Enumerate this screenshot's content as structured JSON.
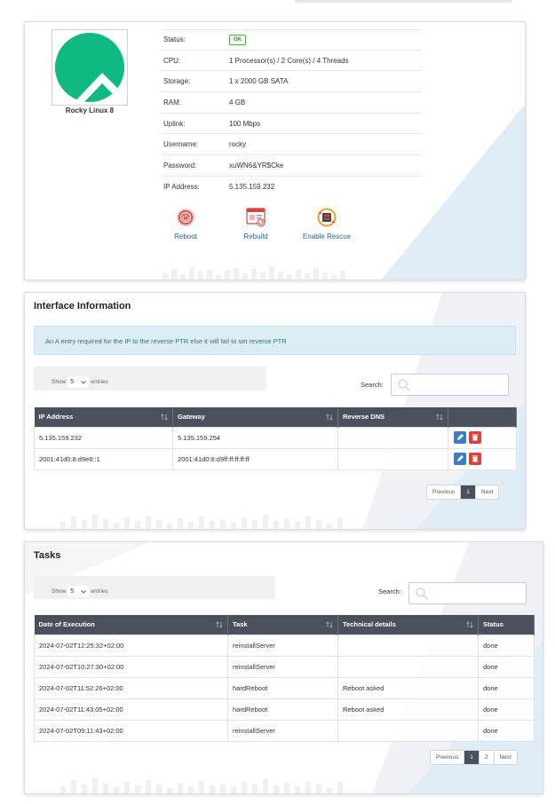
{
  "server": {
    "os_name": "Rocky Linux 8",
    "os_logo_icon": "rocky-linux-logo",
    "specs": [
      {
        "key": "Status:",
        "value": "OK",
        "badge": true
      },
      {
        "key": "CPU:",
        "value": "1 Processor(s) / 2 Core(s) / 4 Threads"
      },
      {
        "key": "Storage:",
        "value": "1 x 2000 GB SATA"
      },
      {
        "key": "RAM:",
        "value": "4 GB"
      },
      {
        "key": "Uplink:",
        "value": "100 Mbps"
      },
      {
        "key": "Username:",
        "value": "rocky"
      },
      {
        "key": "Password:",
        "value": "xuWN6&YR$Cke"
      },
      {
        "key": "IP Address:",
        "value": "5.135.159.232"
      }
    ],
    "actions": [
      {
        "label": "Reboot",
        "icon": "power-icon"
      },
      {
        "label": "Rebuild",
        "icon": "rebuild-icon"
      },
      {
        "label": "Enable Rescue",
        "icon": "rescue-icon"
      }
    ]
  },
  "interfaces": {
    "title": "Interface Information",
    "alert": "An A entry required for the IP to the reverse PTR else it will fail to set reverse PTR",
    "length": {
      "show": "Show",
      "value": "5",
      "entries": "entries"
    },
    "search_label": "Search:",
    "columns": [
      "IP Address",
      "Gateway",
      "Reverse DNS",
      ""
    ],
    "rows": [
      {
        "ip": "5.135.159.232",
        "gateway": "5.135.159.254",
        "rdns": ""
      },
      {
        "ip": "2001:41d0:8:d9e8::1",
        "gateway": "2001:41d0:8:d9ff:ff:ff:ff:ff",
        "rdns": ""
      }
    ],
    "pager": {
      "previous": "Previous",
      "pages": [
        "1"
      ],
      "next": "Next"
    }
  },
  "tasks": {
    "title": "Tasks",
    "length": {
      "show": "Show",
      "value": "5",
      "entries": "entries"
    },
    "search_label": "Search:",
    "columns": [
      "Date of Execution",
      "Task",
      "Technical details",
      "Status"
    ],
    "rows": [
      {
        "date": "2024-07-02T12:25:32+02:00",
        "task": "reinstallServer",
        "details": "",
        "status": "done"
      },
      {
        "date": "2024-07-02T10:27:30+02:00",
        "task": "reinstallServer",
        "details": "",
        "status": "done"
      },
      {
        "date": "2024-07-02T11:52:26+02:00",
        "task": "hardReboot",
        "details": "Reboot asked",
        "status": "done"
      },
      {
        "date": "2024-07-02T11:43:05+02:00",
        "task": "hardReboot",
        "details": "Reboot asked",
        "status": "done"
      },
      {
        "date": "2024-07-02T09:11:43+02:00",
        "task": "reinstallServer",
        "details": "",
        "status": "done"
      }
    ],
    "pager": {
      "previous": "Previous",
      "pages": [
        "1",
        "2"
      ],
      "next": "Next"
    }
  },
  "colors": {
    "table_header": "#4a505c",
    "link": "#2a6496",
    "ok": "#4cae4c",
    "alert_bg": "#dcedf6",
    "edit": "#3a7fc5",
    "delete": "#d9433b"
  }
}
